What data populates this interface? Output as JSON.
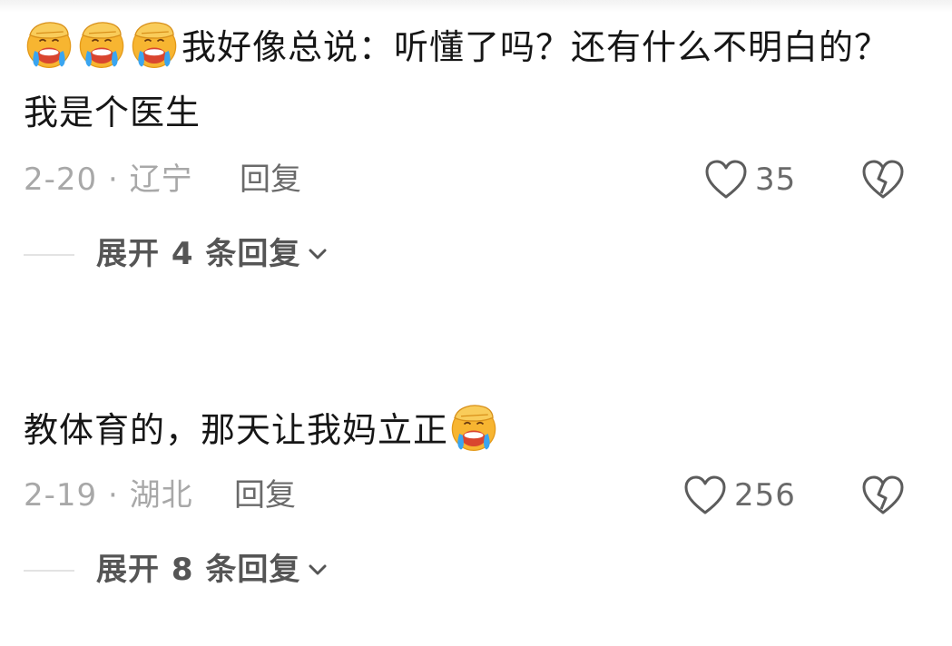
{
  "comments": [
    {
      "text": "我好像总说：听懂了吗？还有什么不明白的？我是个医生",
      "leading_emoji": "face-palm-cry-emoji",
      "emoji_count_before": 3,
      "date_location": "2-20 · 辽宁",
      "reply_label": "回复",
      "likes": "35",
      "expand_label": "展开 4 条回复"
    },
    {
      "username": "",
      "text": "教体育的，那天让我妈立正",
      "trailing_emoji": "face-palm-cry-emoji",
      "date_location": "2-19 · 湖北",
      "reply_label": "回复",
      "likes": "256",
      "expand_label": "展开 8 条回复"
    }
  ],
  "colors": {
    "text": "#161616",
    "meta": "#a8a8a8",
    "action": "#6a6a6a",
    "emoji_face": "#f7b531"
  },
  "icons": {
    "like": "heart-outline-icon",
    "dislike": "broken-heart-icon",
    "expand": "chevron-down-icon"
  }
}
